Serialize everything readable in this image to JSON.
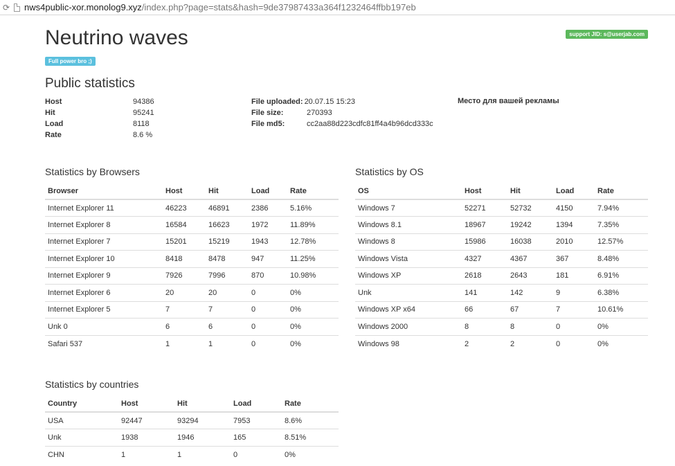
{
  "browser": {
    "url_host": "nws4public-xor.monolog9.xyz",
    "url_path": "/index.php?page=stats&hash=9de37987433a364f1232464ffbb197eb"
  },
  "header": {
    "title": "Neutrino waves",
    "badge": "Full power bro ;)",
    "support": "support JID: s@userjab.com"
  },
  "public": {
    "title": "Public statistics",
    "host_label": "Host",
    "host_value": "94386",
    "hit_label": "Hit",
    "hit_value": "95241",
    "load_label": "Load",
    "load_value": "8118",
    "rate_label": "Rate",
    "rate_value": "8.6 %",
    "uploaded_label": "File uploaded:",
    "uploaded_value": "20.07.15 15:23",
    "size_label": "File size:",
    "size_value": "270393",
    "md5_label": "File md5:",
    "md5_value": "cc2aa88d223cdfc81ff4a4b96dcd333c",
    "ad": "Место для вашей рекламы"
  },
  "browsers": {
    "title": "Statistics by Browsers",
    "columns": [
      "Browser",
      "Host",
      "Hit",
      "Load",
      "Rate"
    ],
    "rows": [
      [
        "Internet Explorer 11",
        "46223",
        "46891",
        "2386",
        "5.16%"
      ],
      [
        "Internet Explorer 8",
        "16584",
        "16623",
        "1972",
        "11.89%"
      ],
      [
        "Internet Explorer 7",
        "15201",
        "15219",
        "1943",
        "12.78%"
      ],
      [
        "Internet Explorer 10",
        "8418",
        "8478",
        "947",
        "11.25%"
      ],
      [
        "Internet Explorer 9",
        "7926",
        "7996",
        "870",
        "10.98%"
      ],
      [
        "Internet Explorer 6",
        "20",
        "20",
        "0",
        "0%"
      ],
      [
        "Internet Explorer 5",
        "7",
        "7",
        "0",
        "0%"
      ],
      [
        "Unk 0",
        "6",
        "6",
        "0",
        "0%"
      ],
      [
        "Safari 537",
        "1",
        "1",
        "0",
        "0%"
      ]
    ]
  },
  "os": {
    "title": "Statistics by OS",
    "columns": [
      "OS",
      "Host",
      "Hit",
      "Load",
      "Rate"
    ],
    "rows": [
      [
        "Windows 7",
        "52271",
        "52732",
        "4150",
        "7.94%"
      ],
      [
        "Windows 8.1",
        "18967",
        "19242",
        "1394",
        "7.35%"
      ],
      [
        "Windows 8",
        "15986",
        "16038",
        "2010",
        "12.57%"
      ],
      [
        "Windows Vista",
        "4327",
        "4367",
        "367",
        "8.48%"
      ],
      [
        "Windows XP",
        "2618",
        "2643",
        "181",
        "6.91%"
      ],
      [
        "Unk",
        "141",
        "142",
        "9",
        "6.38%"
      ],
      [
        "Windows XP x64",
        "66",
        "67",
        "7",
        "10.61%"
      ],
      [
        "Windows 2000",
        "8",
        "8",
        "0",
        "0%"
      ],
      [
        "Windows 98",
        "2",
        "2",
        "0",
        "0%"
      ]
    ]
  },
  "countries": {
    "title": "Statistics by countries",
    "columns": [
      "Country",
      "Host",
      "Hit",
      "Load",
      "Rate"
    ],
    "rows": [
      [
        "USA",
        "92447",
        "93294",
        "7953",
        "8.6%"
      ],
      [
        "Unk",
        "1938",
        "1946",
        "165",
        "8.51%"
      ],
      [
        "CHN",
        "1",
        "1",
        "0",
        "0%"
      ]
    ]
  }
}
